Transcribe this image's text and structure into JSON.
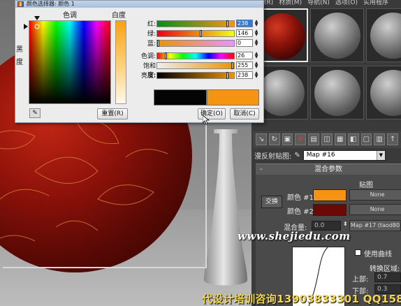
{
  "material_editor": {
    "menu": [
      "(R)",
      "材质(M)",
      "导航(N)",
      "选项(O)",
      "实用程序"
    ],
    "map_row": {
      "label": "漫反射贴图:",
      "value": "Map #16"
    },
    "rollout": {
      "title": "混合参数",
      "maps_header": "贴图",
      "color1_label": "颜色 #1",
      "color1_value": "#f59312",
      "color1_map": "None",
      "color2_label": "颜色 #2",
      "color2_value": "#6b0a04",
      "color2_map": "None",
      "swap_label": "交换",
      "mix_label": "混合量:",
      "mix_value": "0.0",
      "mix_map": "Map #17 (taod80",
      "use_curve_label": "使用曲线",
      "transition_label": "转换区域:",
      "upper_label": "上部:",
      "upper_value": "0.7",
      "lower_label": "下部:",
      "lower_value": "0.3"
    }
  },
  "color_dialog": {
    "title": "颜色选择器: 颜色 1",
    "hue_label": "色调",
    "whiteness_label": "白度",
    "blackness_label": "黑\n度",
    "sliders": [
      {
        "label": "红:",
        "value": "238",
        "pos": 238,
        "selected": true,
        "gradient": "linear-gradient(90deg,#009214,#ff9214)"
      },
      {
        "label": "绿:",
        "value": "146",
        "pos": 146,
        "selected": false,
        "gradient": "linear-gradient(90deg,#ee0014,#eeff14)"
      },
      {
        "label": "蓝:",
        "value": "0",
        "pos": 0,
        "selected": false,
        "gradient": "linear-gradient(90deg,#ee9200,#ee92ff)"
      },
      {
        "label": "色调:",
        "value": "26",
        "pos": 26,
        "selected": false,
        "gradient": "linear-gradient(90deg,#f00,#ff0,#0f0,#0ff,#00f,#f0f,#f00)"
      },
      {
        "label": "饱和度:",
        "value": "255",
        "pos": 255,
        "selected": false,
        "gradient": "linear-gradient(90deg,#eeeeee,#ee9200)"
      },
      {
        "label": "亮度:",
        "value": "238",
        "pos": 238,
        "selected": false,
        "gradient": "linear-gradient(90deg,#000000,#ee9200)"
      }
    ],
    "reset_label": "重置(R)",
    "ok_label": "确定(O)",
    "cancel_label": "取消(C)",
    "old_color": "#040404",
    "new_color": "#f59312"
  },
  "watermark": {
    "site": "www.shejiedu.com",
    "contact": "代设计培训咨询13903833301 QQ158"
  }
}
